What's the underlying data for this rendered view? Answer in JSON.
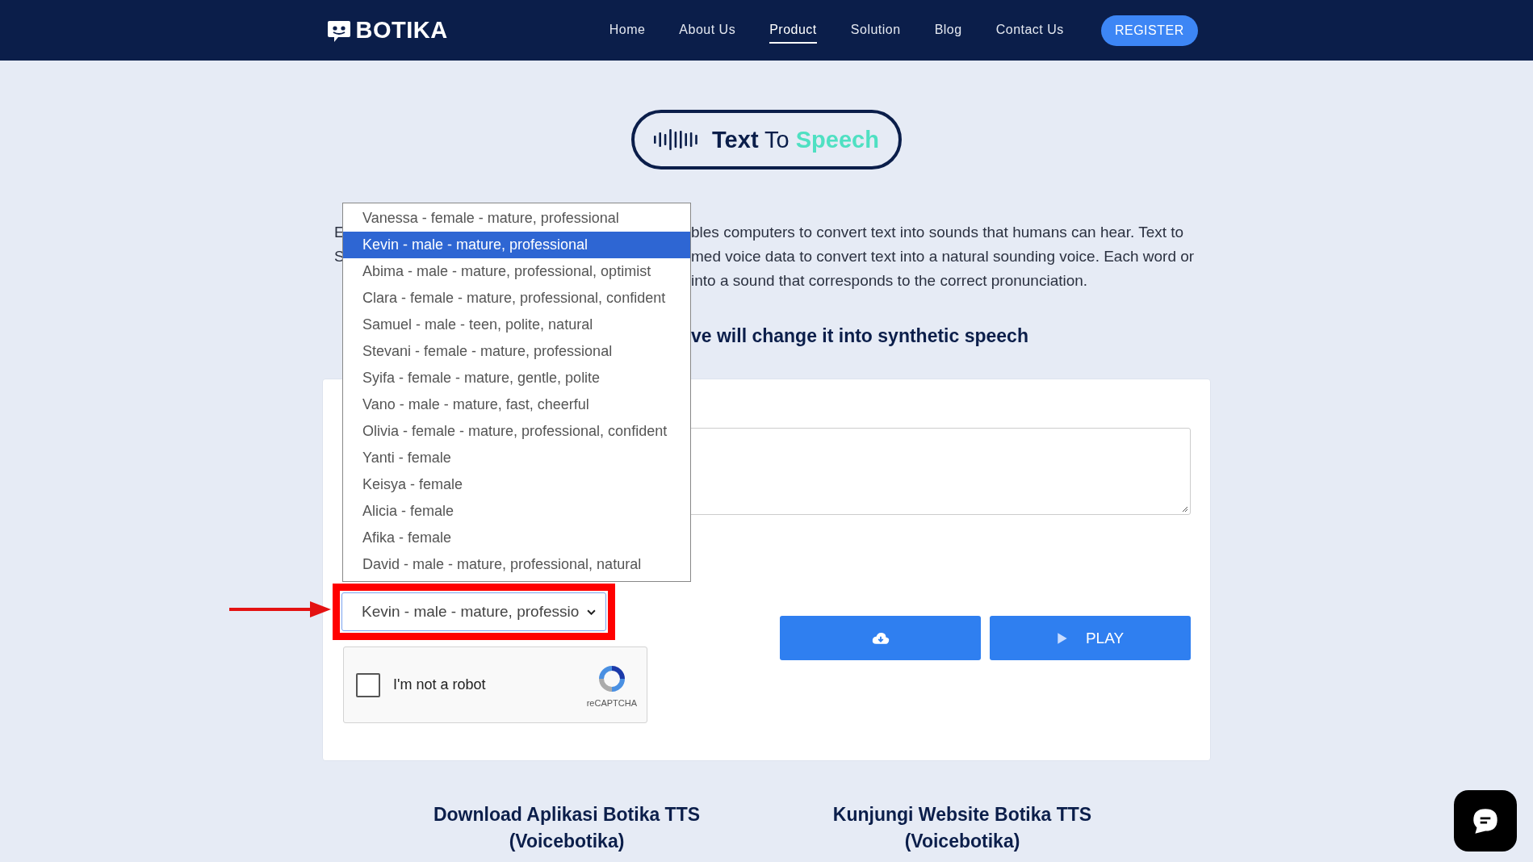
{
  "nav": {
    "logo": "BOTIKA",
    "links": [
      {
        "label": "Home",
        "selected": false
      },
      {
        "label": "About Us",
        "selected": false
      },
      {
        "label": "Product",
        "selected": true
      },
      {
        "label": "Solution",
        "selected": false
      },
      {
        "label": "Blog",
        "selected": false
      },
      {
        "label": "Contact Us",
        "selected": false
      }
    ],
    "register": "REGISTER"
  },
  "title": {
    "bold": "Text",
    "middle": "To",
    "accent": "Speech"
  },
  "intro_lines": [
    {
      "left": "E",
      "right": "bles computers to convert text into sounds that humans can hear. Text to"
    },
    {
      "left": "S",
      "right": "med voice data to convert text into a natural sounding voice. Each word or"
    },
    {
      "right": "into a sound that corresponds to the correct pronunciation."
    }
  ],
  "heading": "ve will change it into synthetic speech",
  "voice_menu": [
    {
      "label": "Vanessa - female - mature, professional",
      "selected": false
    },
    {
      "label": "Kevin - male - mature, professional",
      "selected": true
    },
    {
      "label": "Abima - male - mature, professional, optimist",
      "selected": false
    },
    {
      "label": "Clara - female - mature, professional, confident",
      "selected": false
    },
    {
      "label": "Samuel - male - teen, polite, natural",
      "selected": false
    },
    {
      "label": "Stevani - female - mature, professional",
      "selected": false
    },
    {
      "label": "Syifa - female - mature, gentle, polite",
      "selected": false
    },
    {
      "label": "Vano - male - mature, fast, cheerful",
      "selected": false
    },
    {
      "label": "Olivia - female - mature, professional, confident",
      "selected": false
    },
    {
      "label": "Yanti - female",
      "selected": false
    },
    {
      "label": "Keisya - female",
      "selected": false
    },
    {
      "label": "Alicia - female",
      "selected": false
    },
    {
      "label": "Afika - female",
      "selected": false
    },
    {
      "label": "David - male - mature, professional, natural",
      "selected": false
    }
  ],
  "voice_select": {
    "value": "Kevin - male - mature, professio"
  },
  "captcha": {
    "label": "I'm not a robot",
    "brand": "reCAPTCHA",
    "checked": false
  },
  "play_button": "PLAY",
  "links": [
    "Download Aplikasi Botika TTS (Voicebotika)",
    "Kunjungi Website Botika TTS (Voicebotika)"
  ]
}
